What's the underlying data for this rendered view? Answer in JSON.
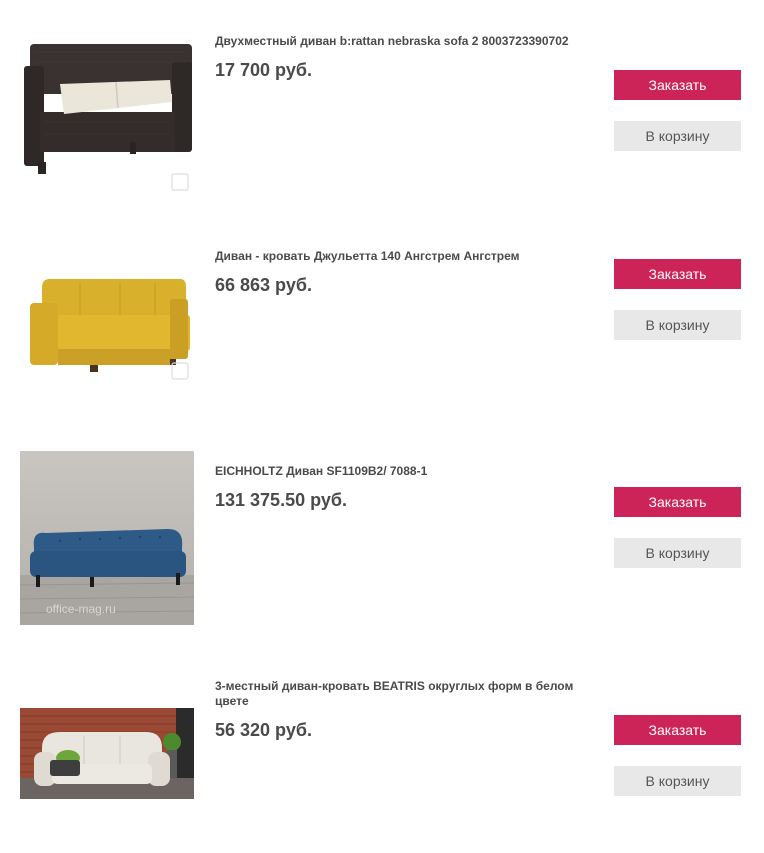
{
  "buttons": {
    "order_label": "Заказать",
    "cart_label": "В корзину"
  },
  "products": [
    {
      "title": "Двухместный диван b:rattan nebraska sofa 2 8003723390702",
      "price": "17 700 руб."
    },
    {
      "title": "Диван - кровать Джульетта 140 Ангстрем Ангстрем",
      "price": "66 863 руб."
    },
    {
      "title": "EICHHOLTZ Диван SF1109B2/ 7088-1",
      "price": "131 375.50 руб."
    },
    {
      "title": "3-местный диван-кровать BEATRIS округлых форм в белом цвете",
      "price": "56 320 руб."
    }
  ],
  "colors": {
    "order_button": "#cc2358",
    "cart_button": "#e8e8e8",
    "text": "#4a4a4a"
  },
  "watermarks": {
    "product_3": "office-mag.ru"
  }
}
